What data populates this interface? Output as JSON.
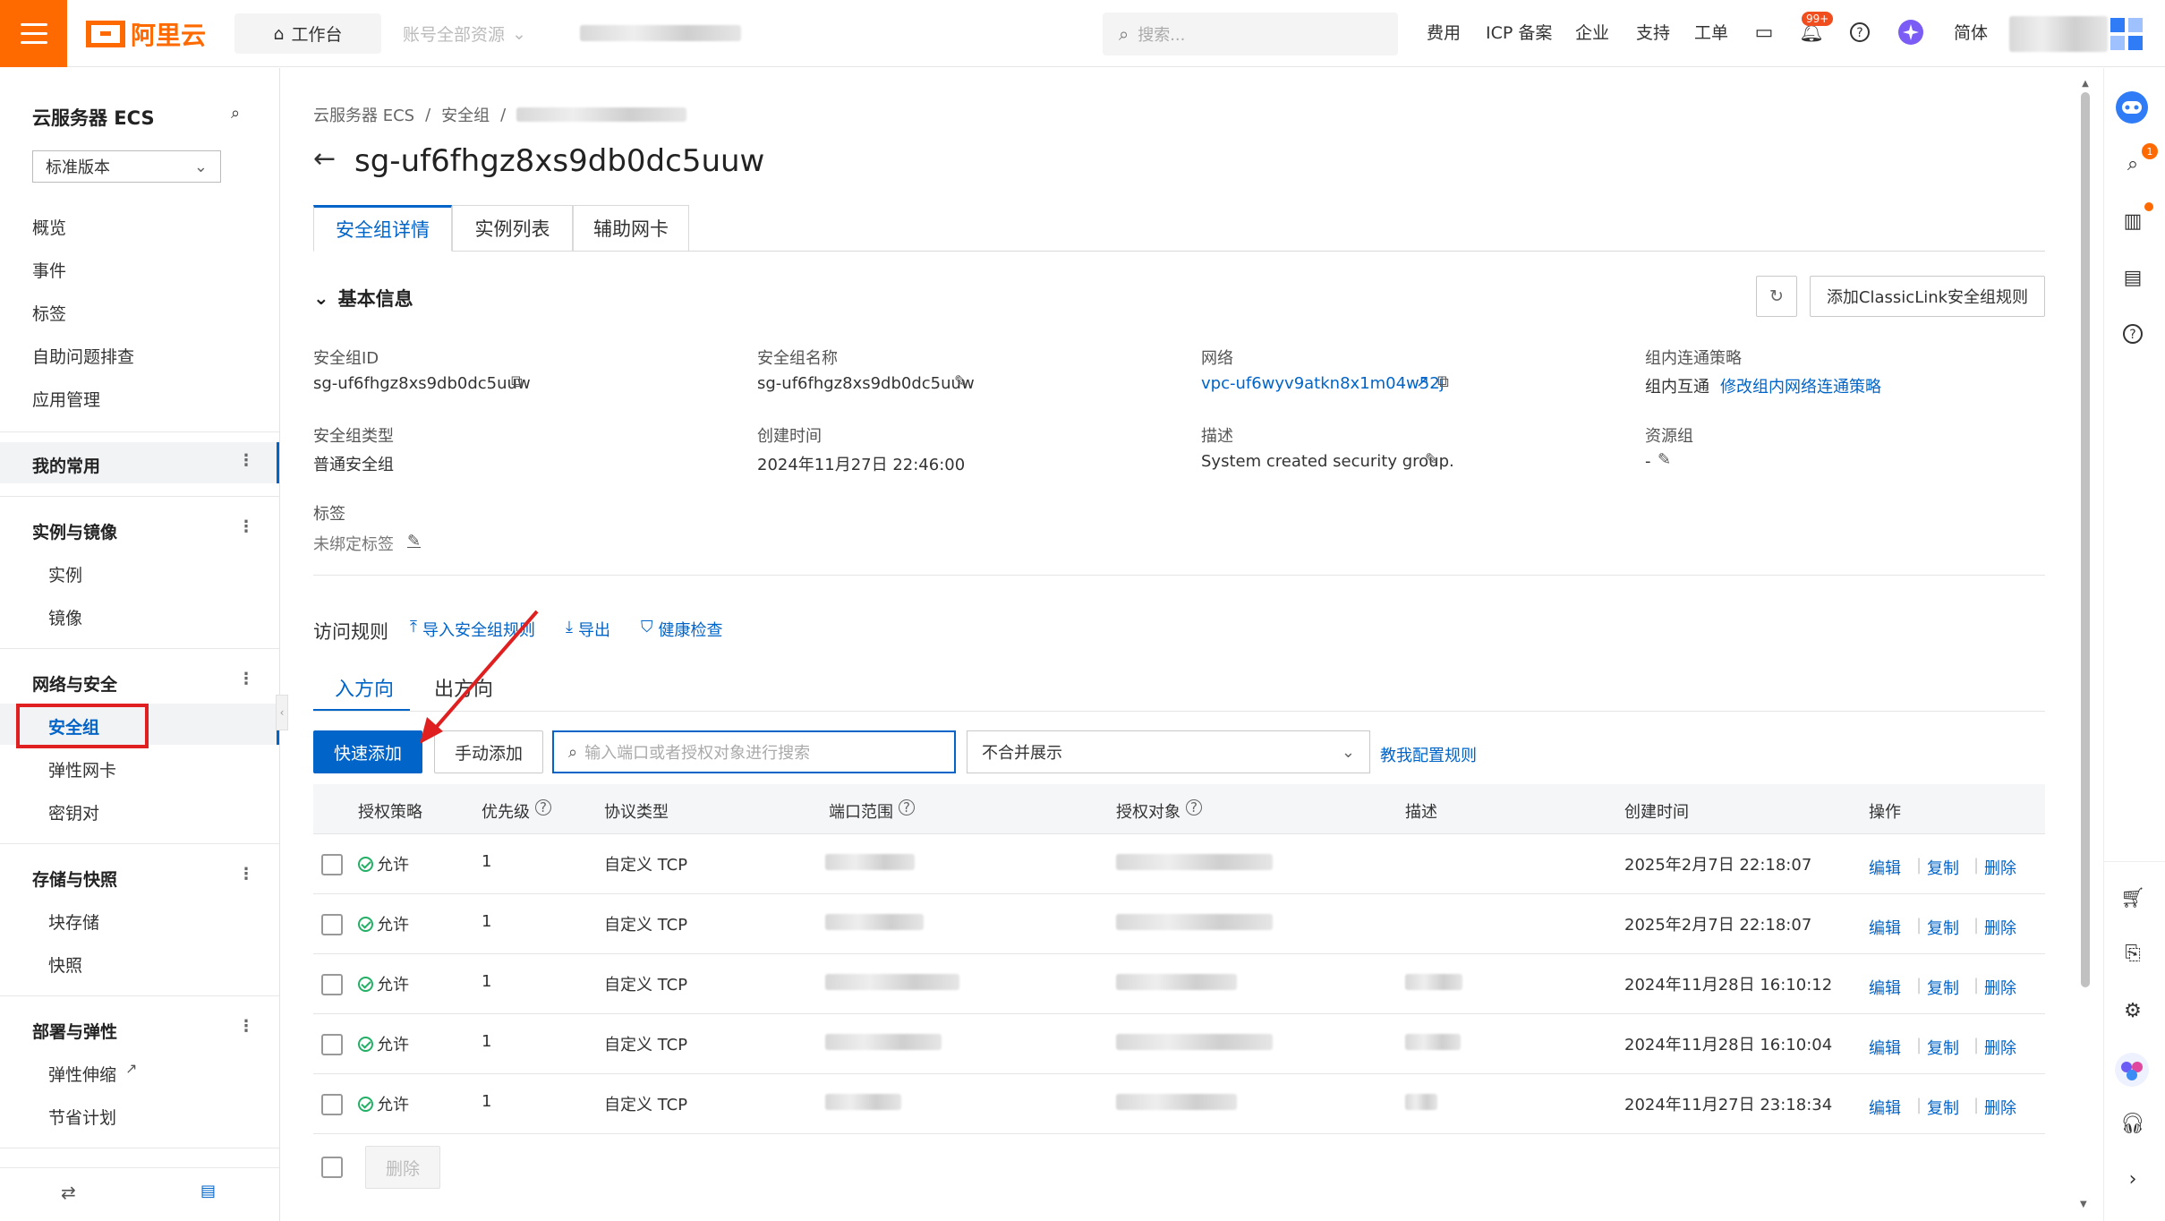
{
  "topbar": {
    "logo_text": "阿里云",
    "workbench": "工作台",
    "account_resources": "账号全部资源",
    "search_placeholder": "搜索...",
    "nav": [
      "费用",
      "ICP 备案",
      "企业",
      "支持",
      "工单"
    ],
    "notification_badge": "99+",
    "language": "简体"
  },
  "sidebar": {
    "title": "云服务器 ECS",
    "version_select": "标准版本",
    "items": [
      "概览",
      "事件",
      "标签",
      "自助问题排查",
      "应用管理"
    ],
    "groups": [
      {
        "title": "我的常用",
        "items": []
      },
      {
        "title": "实例与镜像",
        "items": [
          "实例",
          "镜像"
        ]
      },
      {
        "title": "网络与安全",
        "items": [
          "安全组",
          "弹性网卡",
          "密钥对"
        ]
      },
      {
        "title": "存储与快照",
        "items": [
          "块存储",
          "快照"
        ]
      },
      {
        "title": "部署与弹性",
        "items": [
          "弹性伸缩",
          "节省计划"
        ]
      }
    ]
  },
  "breadcrumb": [
    "云服务器 ECS",
    "安全组"
  ],
  "page_title": "sg-uf6fhgz8xs9db0dc5uuw",
  "tabs": [
    "安全组详情",
    "实例列表",
    "辅助网卡"
  ],
  "basic_info": {
    "section_title": "基本信息",
    "add_classiclink_button": "添加ClassicLink安全组规则",
    "fields": {
      "sg_id_label": "安全组ID",
      "sg_id": "sg-uf6fhgz8xs9db0dc5uuw",
      "sg_name_label": "安全组名称",
      "sg_name": "sg-uf6fhgz8xs9db0dc5uuw",
      "network_label": "网络",
      "network": "vpc-uf6wyv9atkn8x1m04w52j",
      "policy_label": "组内连通策略",
      "policy": "组内互通",
      "policy_link": "修改组内网络连通策略",
      "sg_type_label": "安全组类型",
      "sg_type": "普通安全组",
      "created_label": "创建时间",
      "created": "2024年11月27日 22:46:00",
      "desc_label": "描述",
      "desc": "System created security group.",
      "resource_group_label": "资源组",
      "resource_group": "-",
      "tags_label": "标签",
      "tags": "未绑定标签"
    }
  },
  "rules": {
    "title": "访问规则",
    "import": "导入安全组规则",
    "export": "导出",
    "health_check": "健康检查",
    "direction_tabs": [
      "入方向",
      "出方向"
    ],
    "quick_add": "快速添加",
    "manual_add": "手动添加",
    "search_placeholder": "输入端口或者授权对象进行搜索",
    "merge_select": "不合并展示",
    "teach_link": "教我配置规则",
    "columns": [
      "授权策略",
      "优先级",
      "协议类型",
      "端口范围",
      "授权对象",
      "描述",
      "创建时间",
      "操作"
    ],
    "rows": [
      {
        "policy": "允许",
        "priority": "1",
        "protocol": "自定义 TCP",
        "created": "2025年2月7日 22:18:07"
      },
      {
        "policy": "允许",
        "priority": "1",
        "protocol": "自定义 TCP",
        "created": "2025年2月7日 22:18:07"
      },
      {
        "policy": "允许",
        "priority": "1",
        "protocol": "自定义 TCP",
        "created": "2024年11月28日 16:10:12"
      },
      {
        "policy": "允许",
        "priority": "1",
        "protocol": "自定义 TCP",
        "created": "2024年11月28日 16:10:04"
      },
      {
        "policy": "允许",
        "priority": "1",
        "protocol": "自定义 TCP",
        "created": "2024年11月27日 23:18:34"
      }
    ],
    "actions": [
      "编辑",
      "复制",
      "删除"
    ],
    "bulk_delete": "删除"
  },
  "colors": {
    "brand": "#ff6a00",
    "primary": "#0064c8",
    "annotation_red": "#e02020"
  }
}
